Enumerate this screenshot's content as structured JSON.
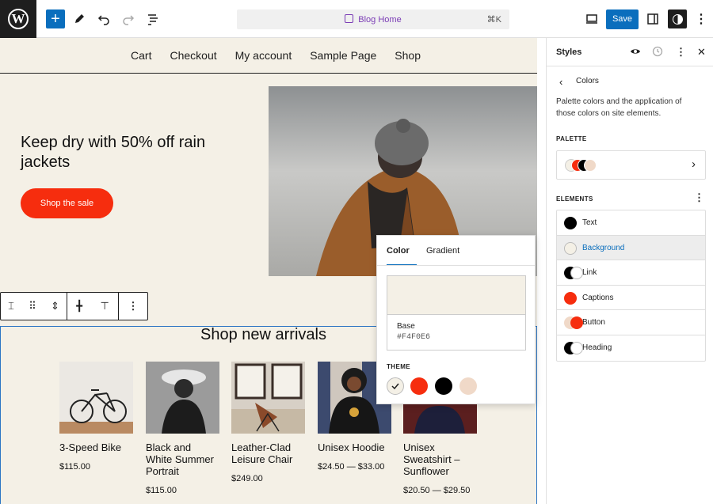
{
  "topbar": {
    "document_title": "Blog Home",
    "shortcut": "⌘K",
    "save_label": "Save"
  },
  "nav": {
    "items": [
      "Cart",
      "Checkout",
      "My account",
      "Sample Page",
      "Shop"
    ]
  },
  "hero": {
    "heading": "Keep dry with 50% off rain jackets",
    "button_label": "Shop the sale"
  },
  "arrivals": {
    "title": "Shop new arrivals",
    "products": [
      {
        "name": "3-Speed Bike",
        "price": "$115.00"
      },
      {
        "name": "Black and White Summer Portrait",
        "price": "$115.00"
      },
      {
        "name": "Leather-Clad Leisure Chair",
        "price": "$249.00"
      },
      {
        "name": "Unisex Hoodie",
        "price": "$24.50 — $33.00"
      },
      {
        "name": "Unisex Sweatshirt – Sunflower",
        "price": "$20.50 — $29.50"
      }
    ]
  },
  "color_popover": {
    "tab_color": "Color",
    "tab_gradient": "Gradient",
    "selected_name": "Base",
    "selected_hex": "#F4F0E6",
    "theme_label": "THEME",
    "theme_colors": [
      "#F4F0E6",
      "#F62D0E",
      "#000000",
      "#F0D9C8"
    ]
  },
  "sidebar": {
    "title": "Styles",
    "subtitle": "Colors",
    "description": "Palette colors and the application of those colors on site elements.",
    "palette_label": "PALETTE",
    "elements_label": "ELEMENTS",
    "elements": [
      {
        "label": "Text"
      },
      {
        "label": "Background"
      },
      {
        "label": "Link"
      },
      {
        "label": "Captions"
      },
      {
        "label": "Button"
      },
      {
        "label": "Heading"
      }
    ]
  },
  "colors": {
    "accent": "#0A6EBD",
    "base": "#F4F0E6",
    "primary": "#F62D0E",
    "contrast": "#000000",
    "tertiary": "#F0D9C8"
  }
}
